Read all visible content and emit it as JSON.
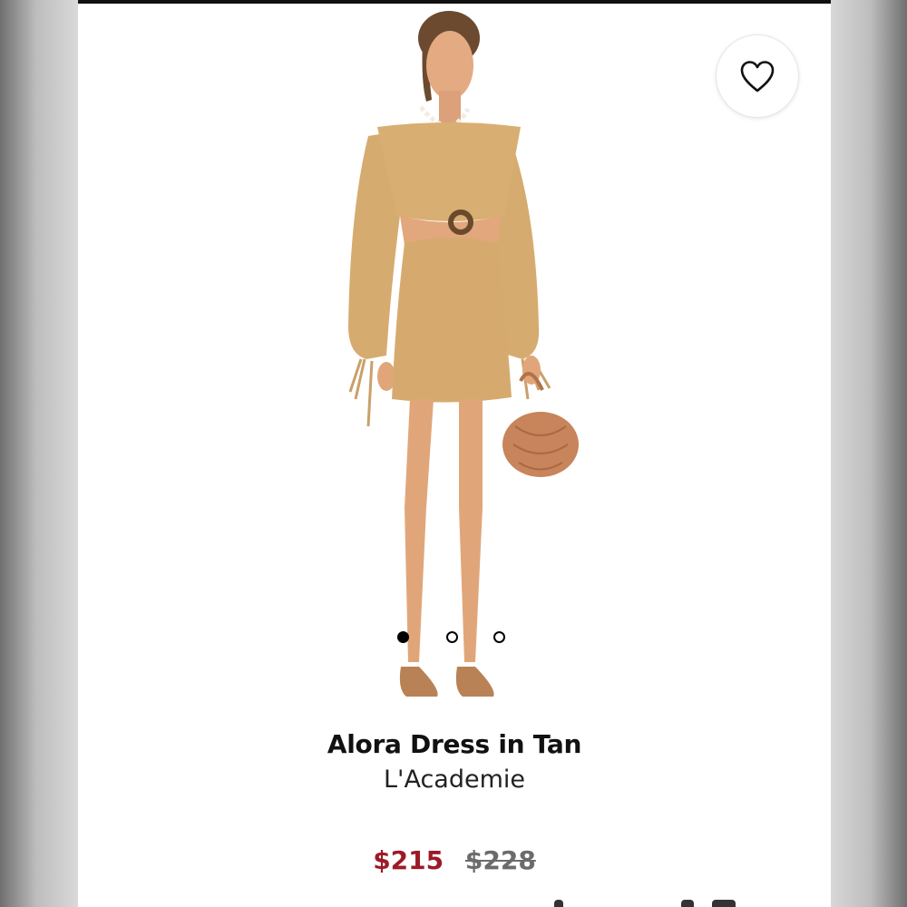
{
  "product": {
    "title": "Alora Dress in Tan",
    "brand": "L'Academie",
    "price_sale": "$215",
    "price_original": "$228"
  },
  "carousel": {
    "total": 3,
    "active_index": 0
  },
  "icons": {
    "favorite": "heart-icon"
  },
  "colors": {
    "sale_price": "#9b1b27",
    "dress": "#d8ae72",
    "skin": "#e0a67a",
    "bag": "#c8845a"
  }
}
